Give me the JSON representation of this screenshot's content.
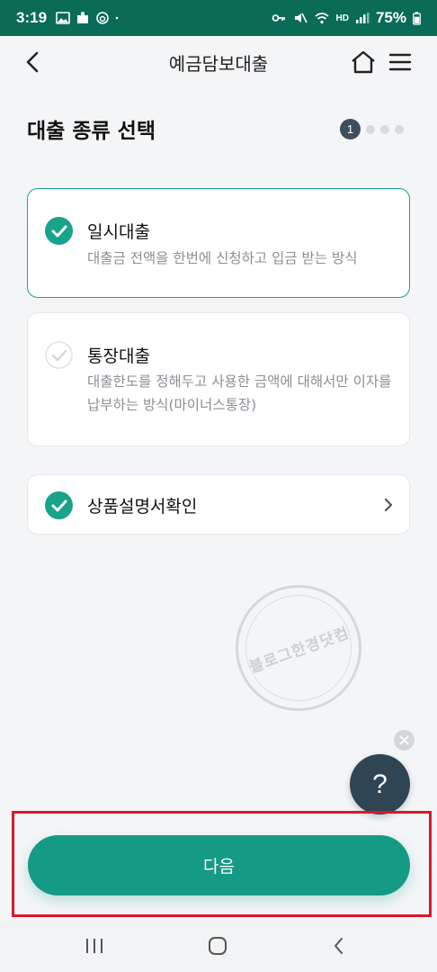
{
  "status_bar": {
    "time": "3:19",
    "network": "HD",
    "battery": "75%",
    "color": "#0a6b56"
  },
  "app_bar": {
    "title": "예금담보대출",
    "back_icon": "chevron-left-icon",
    "home_icon": "home-icon",
    "menu_icon": "hamburger-menu-icon"
  },
  "section": {
    "title": "대출 종류 선택",
    "current_step": "1",
    "total_steps": 4
  },
  "options": [
    {
      "label": "일시대출",
      "description": "대출금 전액을 한번에 신청하고 입금 받는 방식",
      "selected": true
    },
    {
      "label": "통장대출",
      "description": "대출한도를 정해두고 사용한 금액에 대해서만 이자를 납부하는 방식(마이너스통장)",
      "selected": false
    }
  ],
  "product_confirm": {
    "label": "상품설명서확인",
    "checked": true
  },
  "watermark": {
    "text": "블로그한경닷컴"
  },
  "help_button": {
    "label": "?"
  },
  "next_button": {
    "label": "다음",
    "color": "#159a86"
  },
  "colors": {
    "accent": "#18a38a",
    "highlight": "#d8192b"
  }
}
